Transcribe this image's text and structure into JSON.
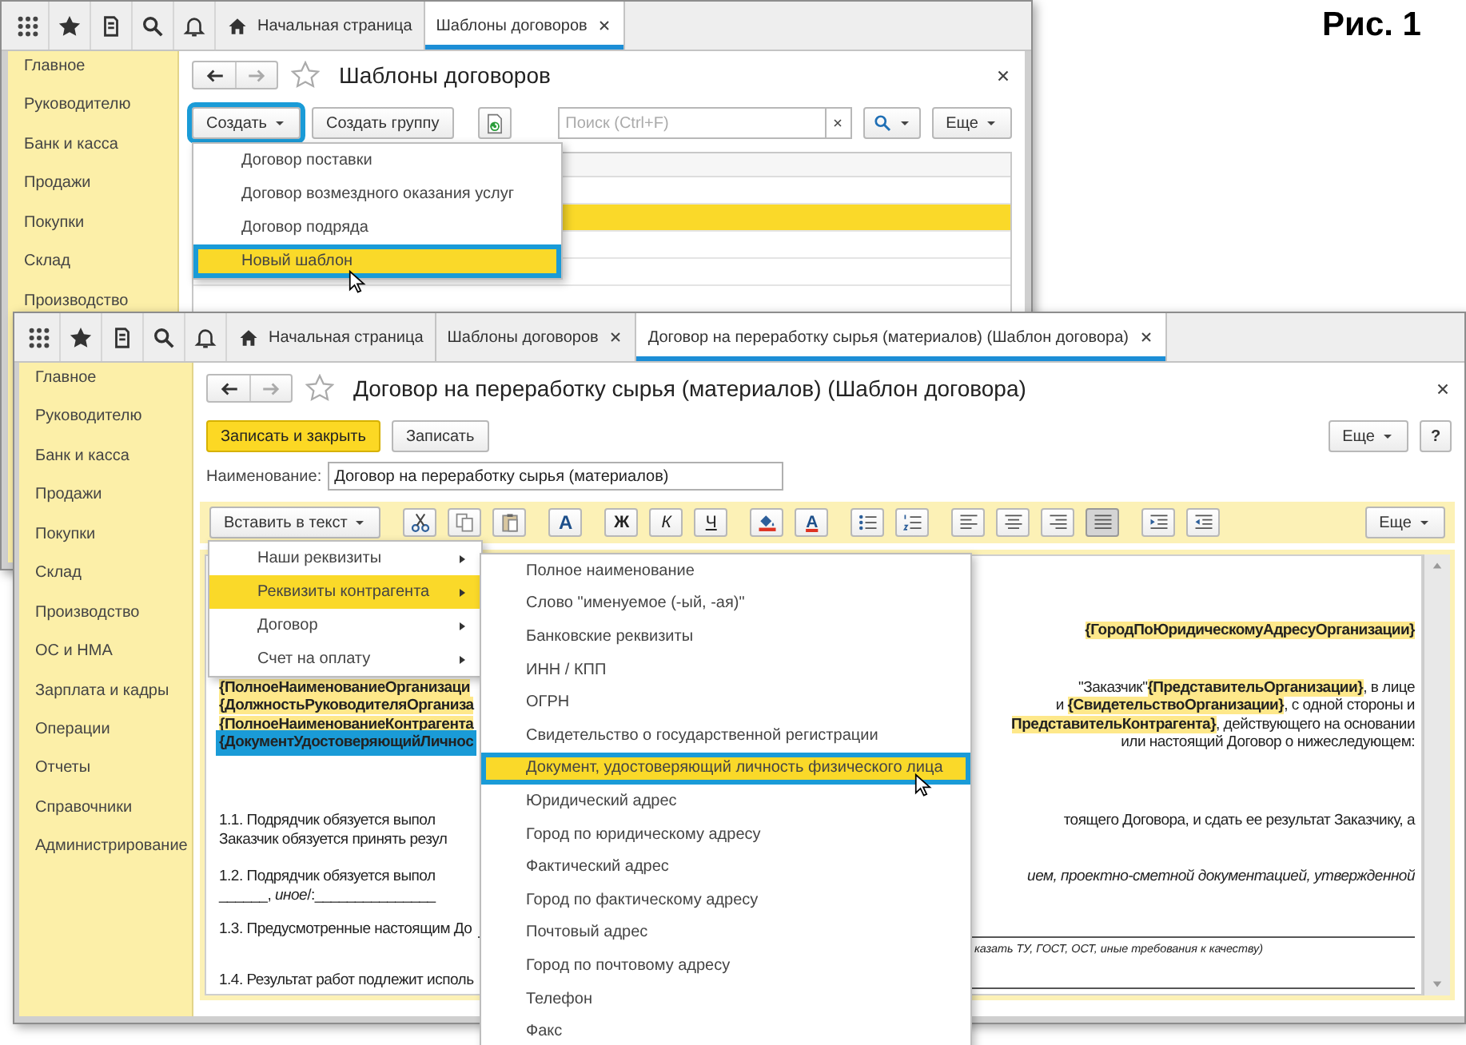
{
  "caption": "Рис. 1",
  "back_window": {
    "tabs": [
      {
        "kind": "home",
        "label": "Начальная страница",
        "selected": false,
        "closable": false
      },
      {
        "kind": "page",
        "label": "Шаблоны договоров",
        "selected": true,
        "closable": true
      }
    ],
    "sidebar": {
      "items": [
        "Главное",
        "Руководителю",
        "Банк и касса",
        "Продажи",
        "Покупки",
        "Склад",
        "Производство"
      ]
    },
    "title": "Шаблоны договоров",
    "toolbar": {
      "create_button": {
        "label": "Создать",
        "highlighted": true
      },
      "group_button": "Создать группу",
      "search": {
        "placeholder": "Поиск (Ctrl+F)"
      },
      "more_button": "Еще"
    },
    "table": {
      "rows": [
        {
          "selected": false
        },
        {
          "selected": true
        },
        {
          "selected": false
        },
        {
          "selected": false
        }
      ]
    },
    "create_menu": {
      "items": [
        {
          "label": "Договор поставки",
          "selected": false,
          "highlighted": false
        },
        {
          "label": "Договор возмездного оказания услуг",
          "selected": false,
          "highlighted": false
        },
        {
          "label": "Договор подряда",
          "selected": false,
          "highlighted": false
        },
        {
          "label": "Новый шаблон",
          "selected": true,
          "highlighted": true
        }
      ]
    }
  },
  "front_window": {
    "tabs": [
      {
        "kind": "home",
        "label": "Начальная страница",
        "selected": false,
        "closable": false
      },
      {
        "kind": "page",
        "label": "Шаблоны договоров",
        "selected": false,
        "closable": true
      },
      {
        "kind": "page",
        "label": "Договор на переработку сырья (материалов) (Шаблон договора)",
        "selected": true,
        "closable": true
      }
    ],
    "sidebar": {
      "items": [
        "Главное",
        "Руководителю",
        "Банк и касса",
        "Продажи",
        "Покупки",
        "Склад",
        "Производство",
        "ОС и НМА",
        "Зарплата и кадры",
        "Операции",
        "Отчеты",
        "Справочники",
        "Администрирование"
      ]
    },
    "title": "Договор на переработку сырья (материалов) (Шаблон договора)",
    "buttons": {
      "save_close": "Записать и закрыть",
      "save": "Записать",
      "more": "Еще",
      "help": "?"
    },
    "name_field": {
      "label": "Наименование:",
      "value": "Договор на переработку сырья (материалов)"
    },
    "format_toolbar": {
      "insert_button": "Вставить в текст",
      "more_button": "Еще",
      "tool_groups": [
        [
          {
            "kind": "cut",
            "pressed": false
          },
          {
            "kind": "copy",
            "pressed": false
          },
          {
            "kind": "paste",
            "pressed": false
          }
        ],
        [
          {
            "kind": "font",
            "label": "A",
            "pressed": false
          }
        ],
        [
          {
            "kind": "bold",
            "label": "Ж",
            "pressed": false
          },
          {
            "kind": "italic",
            "label": "К",
            "pressed": false
          },
          {
            "kind": "underline",
            "label": "Ч",
            "pressed": false
          }
        ],
        [
          {
            "kind": "fill",
            "pressed": false
          },
          {
            "kind": "font-color",
            "label": "A",
            "pressed": false
          }
        ],
        [
          {
            "kind": "bullets",
            "pressed": false
          },
          {
            "kind": "numbering",
            "pressed": false
          }
        ],
        [
          {
            "kind": "align-left",
            "pressed": false
          },
          {
            "kind": "align-center",
            "pressed": false
          },
          {
            "kind": "align-right",
            "pressed": false
          },
          {
            "kind": "justify",
            "pressed": true
          }
        ],
        [
          {
            "kind": "indent",
            "pressed": false
          },
          {
            "kind": "outdent",
            "pressed": false
          }
        ]
      ]
    },
    "document": {
      "paragraphs": [
        {
          "lines": [
            {
              "kind": "right",
              "right": "**{ГородПоЮридическомуАдресуОрганизации}**"
            }
          ]
        },
        {
          "lines": [
            {
              "kind": "split",
              "left": "**{ПолноеНаименованиеОрганизаци**",
              "right": "\"Заказчик\"**{ПредставительОрганизации}**, в лице",
              "selected": false
            },
            {
              "kind": "split",
              "left": "**{ДолжностьРуководителяОрганиза**",
              "right": "и **{СвидетельствоОрганизации}**, с одной стороны и",
              "selected": false
            },
            {
              "kind": "split",
              "left": "**{ПолноеНаименованиеКонтрагента**",
              "right": "**ПредставительКонтрагента}**, действующего на основании",
              "selected": false
            },
            {
              "kind": "split",
              "left": "**{ДокументУдостоверяющийЛичнос**",
              "right": "или настоящий Договор о нижеследующем:",
              "selected": true
            }
          ]
        },
        {
          "lines": [
            {
              "kind": "split",
              "left": "1.1. Подрядчик обязуется выпол",
              "right": "тоящего Договора, и сдать ее результат Заказчику, а",
              "selected": false
            },
            {
              "kind": "split",
              "left": "Заказчик обязуется принять резул",
              "selected": false
            }
          ]
        },
        {
          "lines": [
            {
              "kind": "split",
              "left": "1.2. Подрядчик обязуется выпол",
              "right": "*ием, проектно-сметной документацией, утвержденной*",
              "selected": false
            },
            {
              "kind": "split",
              "left": "______, *иное*/:_______________",
              "selected": false
            }
          ]
        },
        {
          "lines": [
            {
              "kind": "rule",
              "left": "1.3. Предусмотренные настоящим До"
            },
            {
              "kind": "note",
              "right": "казать ТУ, ГОСТ, ОСТ, иные требования к качеству)"
            }
          ]
        },
        {
          "lines": [
            {
              "kind": "rule",
              "left": "1.4. Результат работ подлежит исполь"
            }
          ]
        }
      ]
    },
    "insert_menu": {
      "items": [
        {
          "label": "Наши реквизиты",
          "selected": false,
          "highlighted": false
        },
        {
          "label": "Реквизиты контрагента",
          "selected": true,
          "highlighted": false
        },
        {
          "label": "Договор",
          "selected": false,
          "highlighted": false
        },
        {
          "label": "Счет на оплату",
          "selected": false,
          "highlighted": false
        }
      ]
    },
    "submenu": {
      "items": [
        {
          "label": "Полное наименование",
          "selected": false,
          "highlighted": false
        },
        {
          "label": "Слово \"именуемое (-ый, -ая)\"",
          "selected": false,
          "highlighted": false
        },
        {
          "label": "Банковские реквизиты",
          "selected": false,
          "highlighted": false
        },
        {
          "label": "ИНН / КПП",
          "selected": false,
          "highlighted": false
        },
        {
          "label": "ОГРН",
          "selected": false,
          "highlighted": false
        },
        {
          "label": "Свидетельство о государственной регистрации",
          "selected": false,
          "highlighted": false
        },
        {
          "label": "Документ, удостоверяющий личность физического лица",
          "selected": true,
          "highlighted": true
        },
        {
          "label": "Юридический адрес",
          "selected": false,
          "highlighted": false
        },
        {
          "label": "Город по юридическому адресу",
          "selected": false,
          "highlighted": false
        },
        {
          "label": "Фактический адрес",
          "selected": false,
          "highlighted": false
        },
        {
          "label": "Город по фактическому адресу",
          "selected": false,
          "highlighted": false
        },
        {
          "label": "Почтовый адрес",
          "selected": false,
          "highlighted": false
        },
        {
          "label": "Город по почтовому адресу",
          "selected": false,
          "highlighted": false
        },
        {
          "label": "Телефон",
          "selected": false,
          "highlighted": false
        },
        {
          "label": "Факс",
          "selected": false,
          "highlighted": false
        }
      ]
    }
  }
}
